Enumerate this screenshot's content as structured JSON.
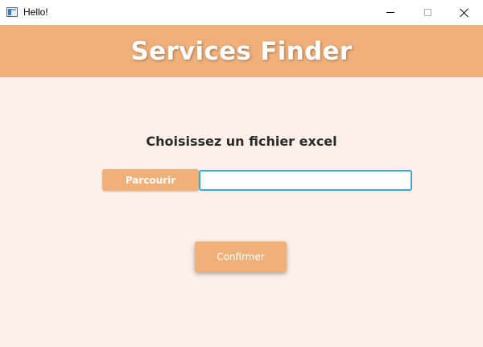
{
  "window": {
    "title": "Hello!",
    "icon": "app-window-icon",
    "controls": [
      "minimize-icon",
      "maximize-icon",
      "close-icon"
    ]
  },
  "header": {
    "title": "Services Finder",
    "background_color": "#f0b07a"
  },
  "main": {
    "prompt": "Choisissez un fichier excel",
    "browse_label": "Parcourir",
    "file_path_value": "",
    "confirm_label": "Confirmer",
    "background_color": "#fcf0e9",
    "accent_color": "#f0b07a",
    "focus_color": "#3aa8de"
  }
}
